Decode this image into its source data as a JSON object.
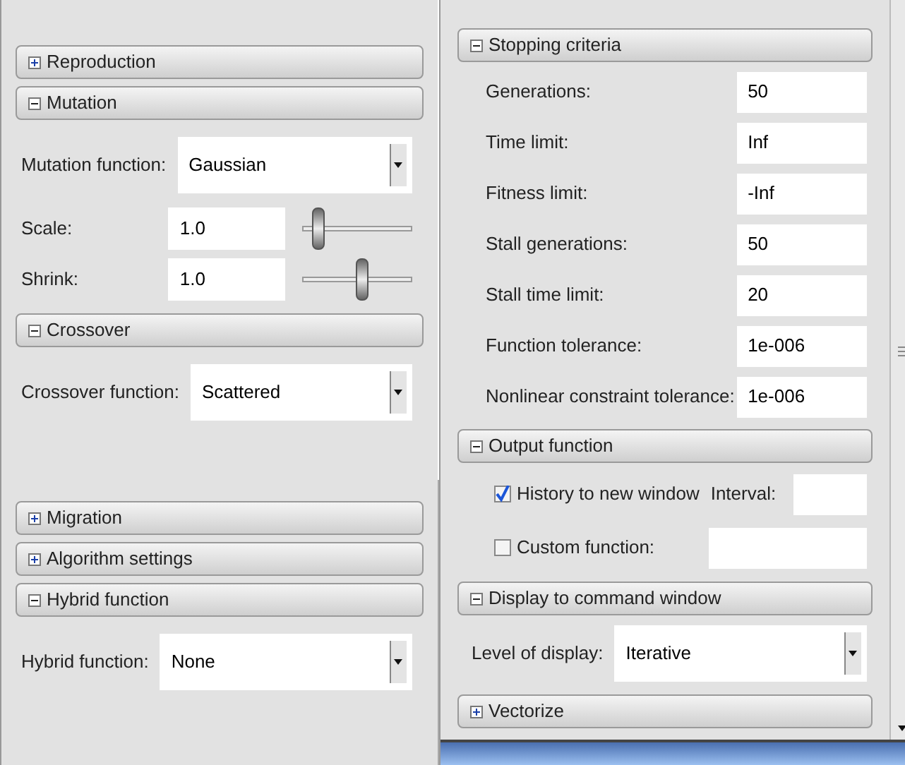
{
  "left_panel": {
    "sections": [
      {
        "title": "Reproduction",
        "expanded": false
      },
      {
        "title": "Mutation",
        "expanded": true,
        "rows": [
          {
            "kind": "dropdown",
            "label": "Mutation function:",
            "value": "Gaussian"
          },
          {
            "kind": "slider",
            "label": "Scale:",
            "value": "1.0",
            "level": 0.1
          },
          {
            "kind": "slider",
            "label": "Shrink:",
            "value": "1.0",
            "level": 0.55
          }
        ]
      },
      {
        "title": "Crossover",
        "expanded": true,
        "rows": [
          {
            "kind": "dropdown",
            "label": "Crossover function:",
            "value": "Scattered"
          }
        ]
      },
      {
        "title": "Migration",
        "expanded": false
      },
      {
        "title": "Algorithm settings",
        "expanded": false
      },
      {
        "title": "Hybrid function",
        "expanded": true,
        "rows": [
          {
            "kind": "dropdown",
            "label": "Hybrid function:",
            "value": "None"
          }
        ]
      }
    ]
  },
  "right_panel": {
    "sections": [
      {
        "title": "Stopping criteria",
        "expanded": true,
        "rows": [
          {
            "kind": "field",
            "label": "Generations:",
            "value": "50"
          },
          {
            "kind": "field",
            "label": "Time limit:",
            "value": "Inf"
          },
          {
            "kind": "field",
            "label": "Fitness limit:",
            "value": "-Inf"
          },
          {
            "kind": "field",
            "label": "Stall generations:",
            "value": "50"
          },
          {
            "kind": "field",
            "label": "Stall time limit:",
            "value": "20"
          },
          {
            "kind": "field",
            "label": "Function tolerance:",
            "value": "1e-006"
          },
          {
            "kind": "field",
            "label": "Nonlinear constraint tolerance:",
            "value": "1e-006"
          }
        ]
      },
      {
        "title": "Output function",
        "expanded": true,
        "rows": [
          {
            "kind": "check",
            "label": "History to new window",
            "checked": true,
            "extra_label": "Interval:"
          },
          {
            "kind": "check",
            "label": "Custom function:",
            "checked": false
          }
        ]
      },
      {
        "title": "Display to command window",
        "expanded": true,
        "rows": [
          {
            "kind": "dropdown",
            "label": "Level of display:",
            "value": "Iterative"
          }
        ]
      },
      {
        "title": "Vectorize",
        "expanded": false
      }
    ]
  }
}
